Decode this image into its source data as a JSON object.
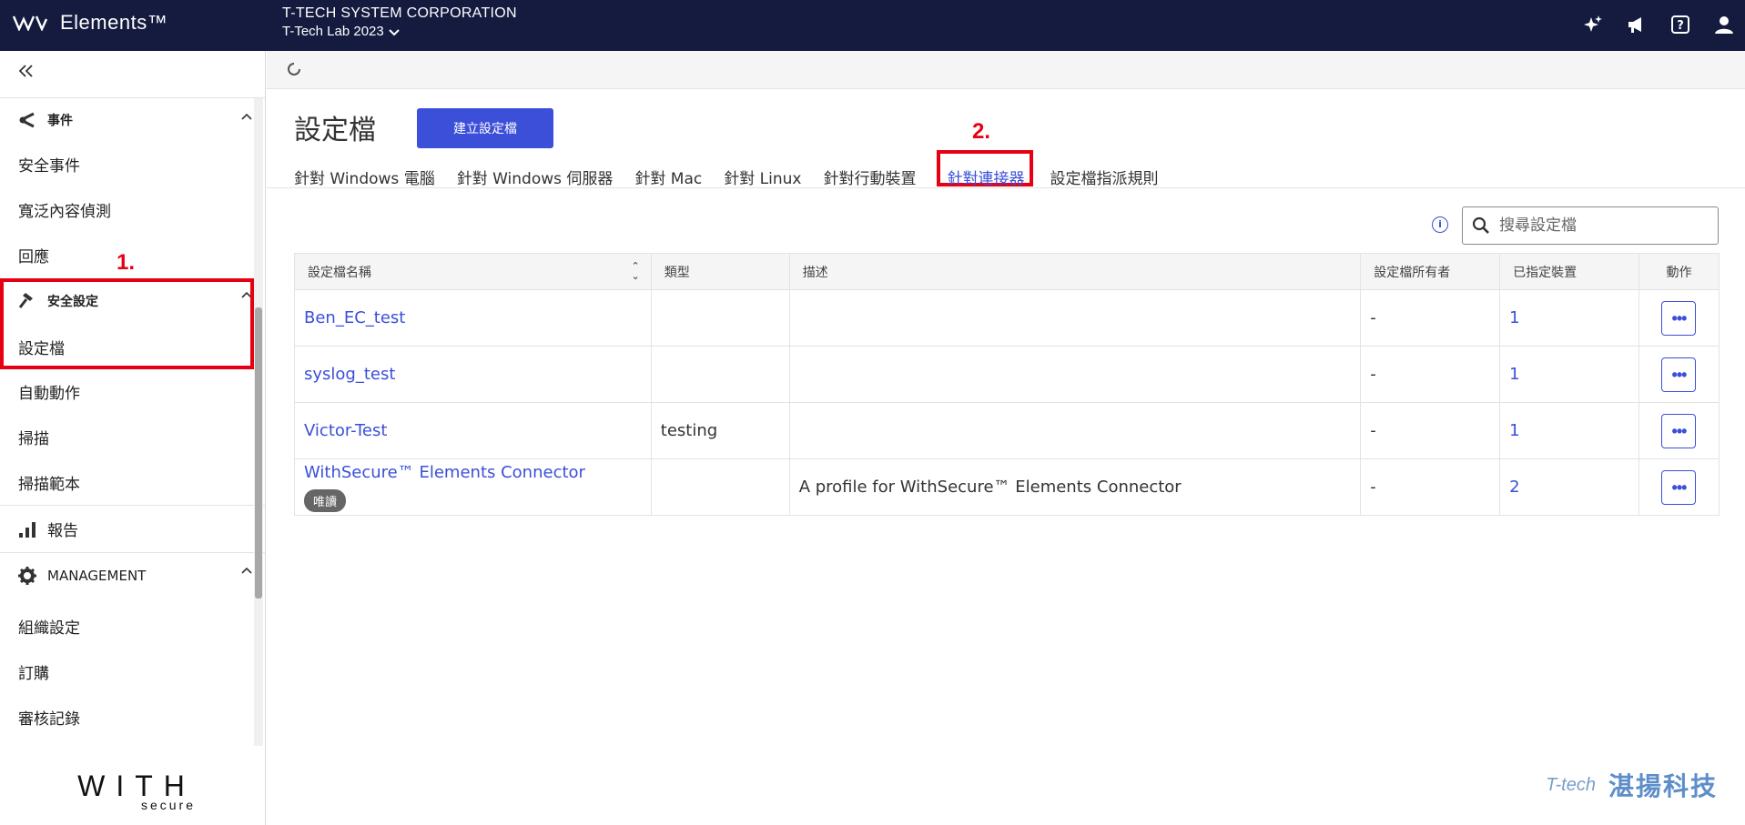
{
  "app": {
    "name": "Elements™"
  },
  "org": {
    "company": "T-TECH SYSTEM CORPORATION",
    "lab": "T-Tech Lab 2023"
  },
  "top_icons": [
    "sparkle-icon",
    "megaphone-icon",
    "help-icon",
    "user-icon"
  ],
  "sidebar": {
    "sections": [
      {
        "label": "事件",
        "icon": "events-icon",
        "items": [
          "安全事件",
          "寬泛內容偵測",
          "回應"
        ]
      },
      {
        "label": "安全設定",
        "icon": "hammer-icon",
        "items": [
          "設定檔",
          "自動動作",
          "掃描",
          "掃描範本"
        ]
      },
      {
        "label": "報告",
        "icon": "bar-chart-icon"
      },
      {
        "label": "MANAGEMENT",
        "icon": "gear-icon",
        "items": [
          "組織設定",
          "訂購",
          "審核記錄"
        ]
      }
    ],
    "footer_logo": {
      "word": "WITH",
      "sub": "secure"
    }
  },
  "annotations": {
    "one": "1.",
    "two": "2."
  },
  "page": {
    "title": "設定檔",
    "create_button": "建立設定檔",
    "tabs": [
      "針對 Windows 電腦",
      "針對 Windows 伺服器",
      "針對 Mac",
      "針對 Linux",
      "針對行動裝置",
      "針對連接器",
      "設定檔指派規則"
    ],
    "active_tab": 5,
    "search_placeholder": "搜尋設定檔"
  },
  "table": {
    "headers": [
      "設定檔名稱",
      "類型",
      "描述",
      "設定檔所有者",
      "已指定裝置",
      "動作"
    ],
    "rows": [
      {
        "name": "Ben_EC_test",
        "type": "",
        "description": "",
        "owner": "-",
        "assigned": "1"
      },
      {
        "name": "syslog_test",
        "type": "",
        "description": "",
        "owner": "-",
        "assigned": "1"
      },
      {
        "name": "Victor-Test",
        "type": "testing",
        "description": "",
        "owner": "-",
        "assigned": "1"
      },
      {
        "name": "WithSecure™ Elements Connector",
        "badge": "唯讀",
        "type": "",
        "description": "A profile for WithSecure™ Elements Connector",
        "owner": "-",
        "assigned": "2"
      }
    ],
    "action_label": "•••"
  },
  "watermark": {
    "latin": "T-tech",
    "chinese": "湛揚科技"
  },
  "colors": {
    "topbar": "#141b3f",
    "accent": "#3b4fd8",
    "highlight": "#e60012"
  }
}
